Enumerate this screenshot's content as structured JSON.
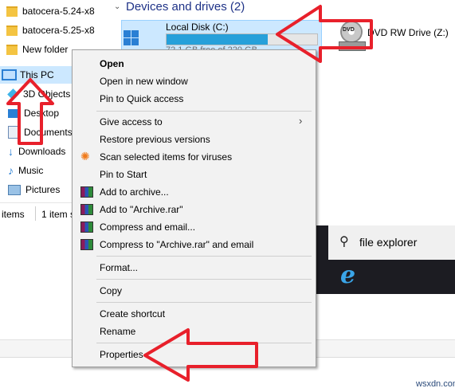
{
  "nav": {
    "folders": [
      "batocera-5.24-x8",
      "batocera-5.25-x8",
      "New folder"
    ],
    "this_pc": "This PC",
    "items": [
      "3D Objects",
      "Desktop",
      "Documents",
      "Downloads",
      "Music",
      "Pictures"
    ]
  },
  "status": {
    "items": "items",
    "selected": "1 item s"
  },
  "devices": {
    "header": "Devices and drives (2)",
    "drive_c": {
      "name": "Local Disk (C:)",
      "free_text": "72.1 GB free of 220 GB",
      "used_fraction": 0.67
    },
    "dvd": {
      "name": "DVD RW Drive (Z:)",
      "badge": "DVD"
    }
  },
  "menu": {
    "open": "Open",
    "open_new_window": "Open in new window",
    "pin_quick": "Pin to Quick access",
    "give_access": "Give access to",
    "restore": "Restore previous versions",
    "scan": "Scan selected items for viruses",
    "pin_start": "Pin to Start",
    "add_archive": "Add to archive...",
    "add_rar": "Add to \"Archive.rar\"",
    "compress_email": "Compress and email...",
    "compress_rar_email": "Compress to \"Archive.rar\" and email",
    "format": "Format...",
    "copy": "Copy",
    "create_shortcut": "Create shortcut",
    "rename": "Rename",
    "properties": "Properties"
  },
  "taskbar": {
    "search_text": "file explorer"
  },
  "watermark": "wsxdn.com",
  "colors": {
    "arrow_red": "#e8202b",
    "selection": "#cce8ff",
    "drive_bar": "#26a0da",
    "header_blue": "#1e3287"
  }
}
